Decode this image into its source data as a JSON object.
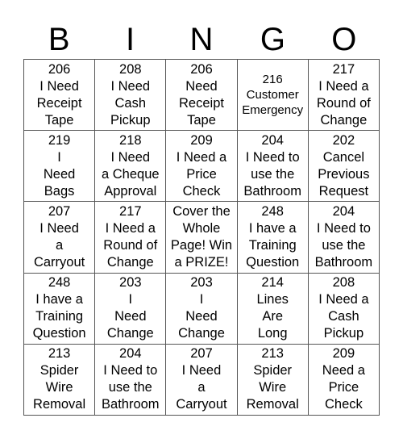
{
  "header": {
    "letters": [
      "B",
      "I",
      "N",
      "G",
      "O"
    ]
  },
  "grid": {
    "rows": [
      [
        {
          "lines": [
            "206",
            "I Need",
            "Receipt",
            "Tape"
          ]
        },
        {
          "lines": [
            "208",
            "I Need",
            "Cash",
            "Pickup"
          ]
        },
        {
          "lines": [
            "206",
            "Need",
            "Receipt",
            "Tape"
          ]
        },
        {
          "lines": [
            "216",
            "Customer",
            "Emergency"
          ],
          "compact": true
        },
        {
          "lines": [
            "217",
            "I Need a",
            "Round of",
            "Change"
          ]
        }
      ],
      [
        {
          "lines": [
            "219",
            "I",
            "Need",
            "Bags"
          ]
        },
        {
          "lines": [
            "218",
            "I Need",
            "a Cheque",
            "Approval"
          ]
        },
        {
          "lines": [
            "209",
            "I Need a",
            "Price",
            "Check"
          ]
        },
        {
          "lines": [
            "204",
            "I Need to",
            "use the",
            "Bathroom"
          ]
        },
        {
          "lines": [
            "202",
            "Cancel",
            "Previous",
            "Request"
          ]
        }
      ],
      [
        {
          "lines": [
            "207",
            "I Need",
            "a",
            "Carryout"
          ]
        },
        {
          "lines": [
            "217",
            "I Need a",
            "Round of",
            "Change"
          ]
        },
        {
          "lines": [
            "Cover the",
            "Whole",
            "Page! Win",
            "a PRIZE!"
          ]
        },
        {
          "lines": [
            "248",
            "I have a",
            "Training",
            "Question"
          ]
        },
        {
          "lines": [
            "204",
            "I Need to",
            "use the",
            "Bathroom"
          ]
        }
      ],
      [
        {
          "lines": [
            "248",
            "I have a",
            "Training",
            "Question"
          ]
        },
        {
          "lines": [
            "203",
            "I",
            "Need",
            "Change"
          ]
        },
        {
          "lines": [
            "203",
            "I",
            "Need",
            "Change"
          ]
        },
        {
          "lines": [
            "214",
            "Lines",
            "Are",
            "Long"
          ]
        },
        {
          "lines": [
            "208",
            "I Need a",
            "Cash",
            "Pickup"
          ]
        }
      ],
      [
        {
          "lines": [
            "213",
            "Spider",
            "Wire",
            "Removal"
          ]
        },
        {
          "lines": [
            "204",
            "I Need to",
            "use the",
            "Bathroom"
          ]
        },
        {
          "lines": [
            "207",
            "I Need",
            "a",
            "Carryout"
          ]
        },
        {
          "lines": [
            "213",
            "Spider",
            "Wire",
            "Removal"
          ]
        },
        {
          "lines": [
            "209",
            "Need a",
            "Price",
            "Check"
          ]
        }
      ]
    ]
  }
}
